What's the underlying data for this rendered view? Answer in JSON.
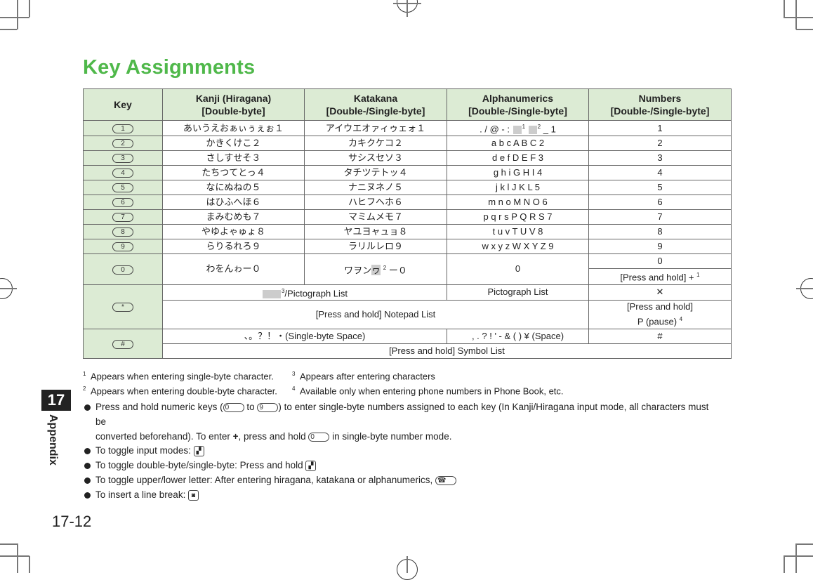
{
  "title": "Key Assignments",
  "table": {
    "headers": [
      {
        "line1": "Key",
        "line2": ""
      },
      {
        "line1": "Kanji (Hiragana)",
        "line2": "[Double-byte]"
      },
      {
        "line1": "Katakana",
        "line2": "[Double-/Single-byte]"
      },
      {
        "line1": "Alphanumerics",
        "line2": "[Double-/Single-byte]"
      },
      {
        "line1": "Numbers",
        "line2": "[Double-/Single-byte]"
      }
    ],
    "rows": [
      {
        "key": "1",
        "kanji": "あいうえおぁぃぅぇぉ１",
        "katakana": "アイウエオァィゥェォ１",
        "alpha_prefix": ". / @ - :",
        "alpha_suffix": "_ 1",
        "numbers": "1"
      },
      {
        "key": "2",
        "kanji": "かきくけこ２",
        "katakana": "カキクケコ２",
        "alpha": "a b c A B C 2",
        "numbers": "2"
      },
      {
        "key": "3",
        "kanji": "さしすせそ３",
        "katakana": "サシスセソ３",
        "alpha": "d e f D E F 3",
        "numbers": "3"
      },
      {
        "key": "4",
        "kanji": "たちつてとっ４",
        "katakana": "タチツテトッ４",
        "alpha": "g h i G H I 4",
        "numbers": "4"
      },
      {
        "key": "5",
        "kanji": "なにぬねの５",
        "katakana": "ナニヌネノ５",
        "alpha": "j k l J K L 5",
        "numbers": "5"
      },
      {
        "key": "6",
        "kanji": "はひふへほ６",
        "katakana": "ハヒフヘホ６",
        "alpha": "m n o M N O 6",
        "numbers": "6"
      },
      {
        "key": "7",
        "kanji": "まみむめも７",
        "katakana": "マミムメモ７",
        "alpha": "p q r s P Q R S 7",
        "numbers": "7"
      },
      {
        "key": "8",
        "kanji": "やゆよゃゅょ８",
        "katakana": "ヤユヨャュョ８",
        "alpha": "t u v T U V 8",
        "numbers": "8"
      },
      {
        "key": "9",
        "kanji": "らりるれろ９",
        "katakana": "ラリルレロ９",
        "alpha": "w x y z W X Y Z 9",
        "numbers": "9"
      }
    ],
    "row0": {
      "key": "0",
      "kanji": "わをんゎー０",
      "katakana_prefix": "ワヲン",
      "katakana_glyph": "ヮ",
      "katakana_sup": "2",
      "katakana_suffix": "ー０",
      "alpha": "0",
      "numbers_1": "0",
      "numbers_2": "[Press and hold] +",
      "numbers_2_sup": "1"
    },
    "rowStar": {
      "key": "*",
      "line1_sup": "3",
      "line1_text": "/Pictograph List",
      "line1_alpha": "Pictograph List",
      "line1_numbers": "✕",
      "line2": "[Press and hold] Notepad List",
      "line2_numbers_1": "[Press and hold]",
      "line2_numbers_2": "P (pause)",
      "line2_numbers_sup": "4"
    },
    "rowHash": {
      "key": "#",
      "line1": "、。？！・(Single-byte Space)",
      "line1_alpha": ", . ? ! ' - & ( ) ¥ (Space)",
      "line1_numbers": "#",
      "line2": "[Press and hold] Symbol List"
    },
    "sup1": "1",
    "sup2": "2"
  },
  "footnotes": [
    {
      "num": "1",
      "text": "Appears when entering single-byte character."
    },
    {
      "num": "2",
      "text": "Appears when entering double-byte character."
    },
    {
      "num": "3",
      "text": "Appears after entering characters"
    },
    {
      "num": "4",
      "text": "Available only when entering phone numbers in Phone Book, etc."
    }
  ],
  "bullets": {
    "b1_a": "Press and hold numeric keys (",
    "b1_k1": "0",
    "b1_b": " to ",
    "b1_k2": "9",
    "b1_c": ") to enter single-byte numbers assigned to each key (In Kanji/Hiragana input mode, all characters must be",
    "b1_d": "converted beforehand). To enter ",
    "b1_plus": "+",
    "b1_e": ", press and hold ",
    "b1_k3": "0",
    "b1_f": " in single-byte number mode.",
    "b2": "To toggle input modes: ",
    "b3": "To toggle double-byte/single-byte: Press and hold ",
    "b4": "To toggle upper/lower letter: After entering hiragana, katakana or alphanumerics, ",
    "b5": "To insert a line break: "
  },
  "chapter": {
    "number": "17",
    "label": "Appendix"
  },
  "page_number": "17-12"
}
